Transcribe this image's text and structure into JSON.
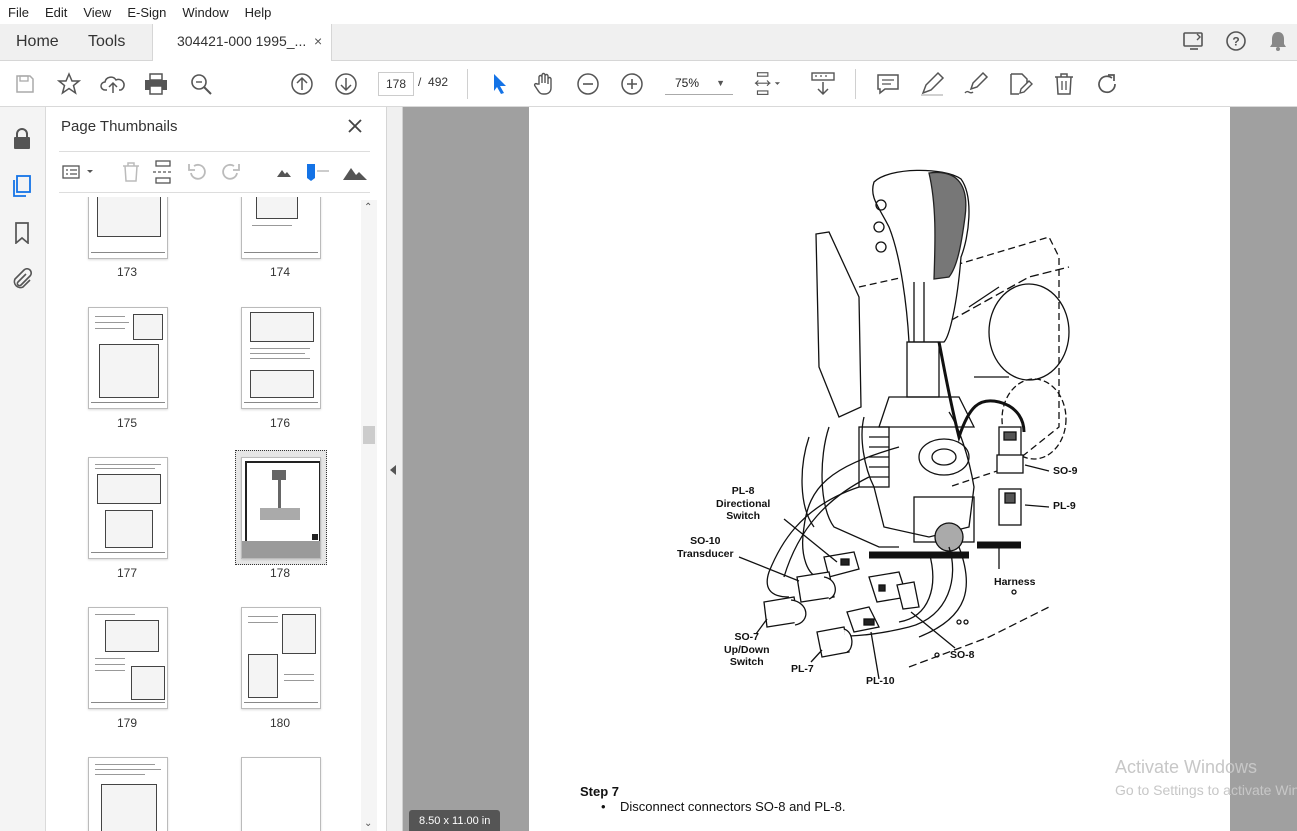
{
  "menu": [
    "File",
    "Edit",
    "View",
    "E-Sign",
    "Window",
    "Help"
  ],
  "tabs": {
    "home": "Home",
    "tools": "Tools",
    "document": "304421-000 1995_...",
    "close_glyph": "×"
  },
  "toolbar": {
    "current_page": "178",
    "page_separator": "/",
    "total_pages": "492",
    "zoom": "75%"
  },
  "panel": {
    "title": "Page Thumbnails",
    "thumbnails": [
      {
        "label": "173"
      },
      {
        "label": "174"
      },
      {
        "label": "175"
      },
      {
        "label": "176"
      },
      {
        "label": "177"
      },
      {
        "label": "178",
        "selected": true
      },
      {
        "label": "179"
      },
      {
        "label": "180"
      },
      {
        "label": ""
      },
      {
        "label": ""
      }
    ]
  },
  "document": {
    "callouts": {
      "pl8": "PL-8\nDirectional\nSwitch",
      "so10": "SO-10\nTransducer",
      "so7": "SO-7\nUp/Down\nSwitch",
      "pl7": "PL-7",
      "pl10": "PL-10",
      "so8": "SO-8",
      "harness": "Harness",
      "so9": "SO-9",
      "pl9": "PL-9"
    },
    "step_title": "Step 7",
    "step_bullet": "•    Disconnect connectors SO-8 and PL-8.",
    "page_size": "8.50 x 11.00 in"
  },
  "watermark": {
    "line1": "Activate Windows",
    "line2": "Go to Settings to activate Windows."
  },
  "colors": {
    "accent": "#1473e6",
    "doc_background": "#a0a0a0"
  }
}
